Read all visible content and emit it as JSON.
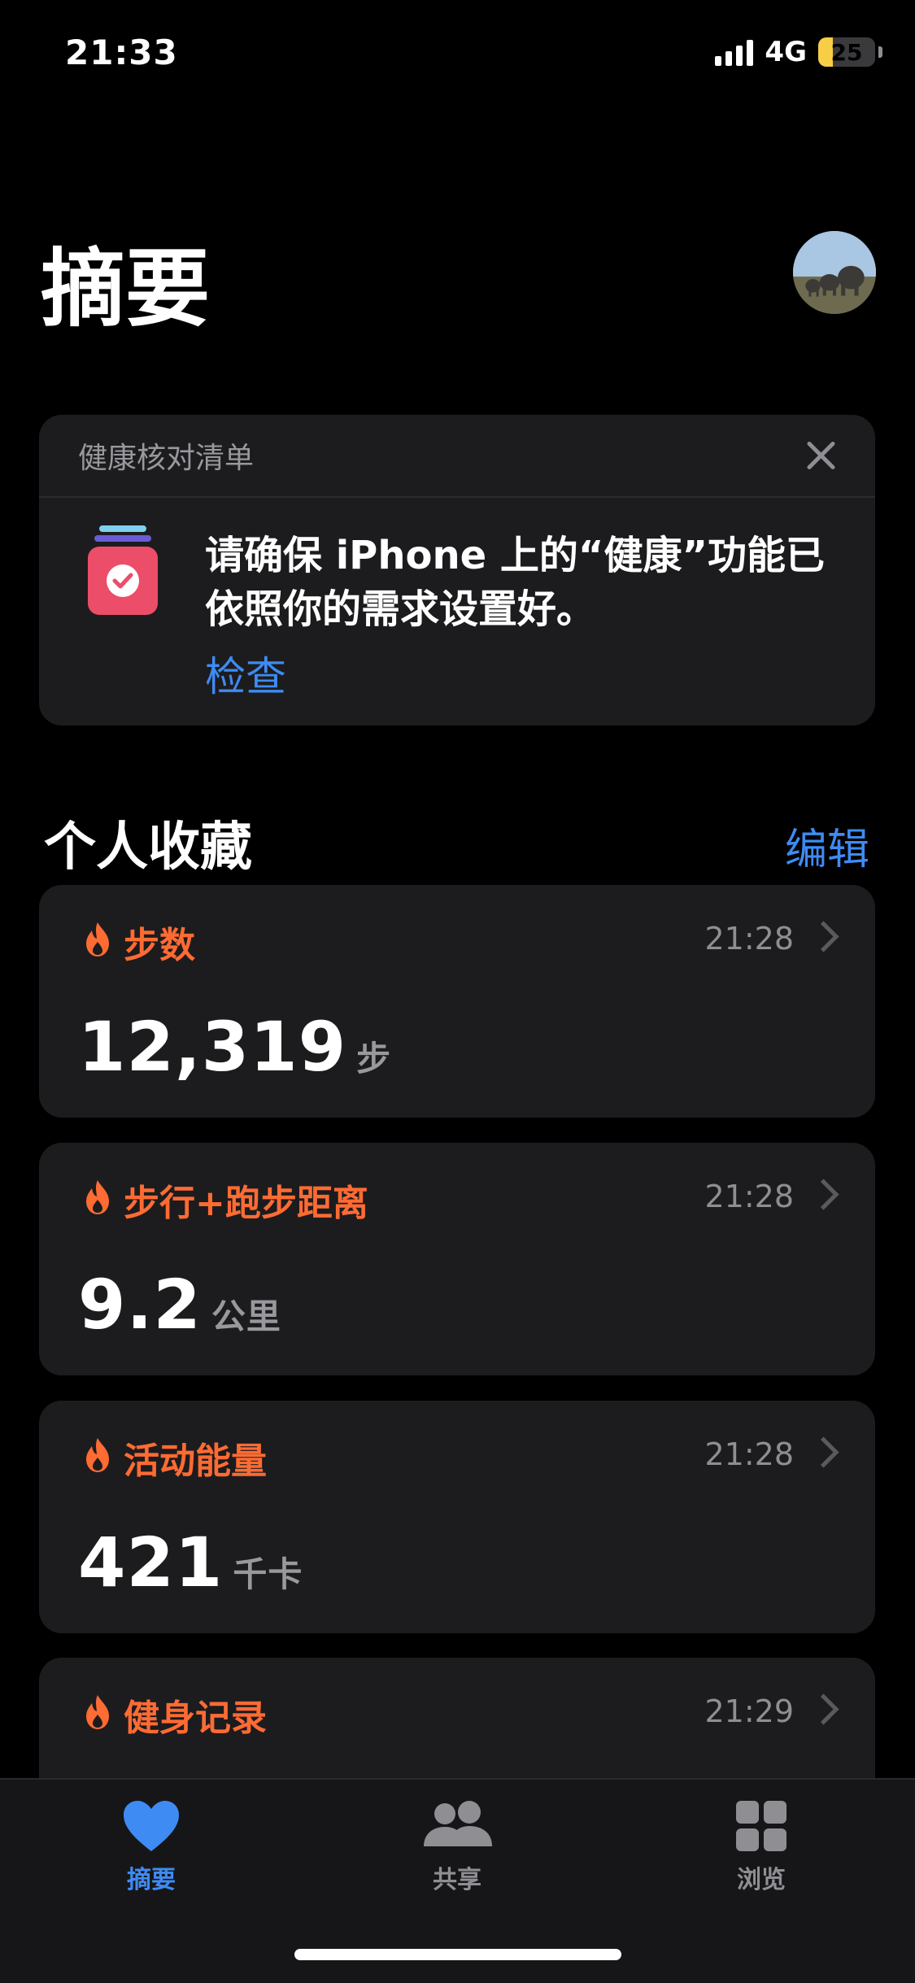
{
  "status_bar": {
    "time": "21:33",
    "network": "4G",
    "battery": "25",
    "battery_level": 0.25
  },
  "header": {
    "title": "摘要"
  },
  "checklist": {
    "title": "健康核对清单",
    "message": "请确保 iPhone 上的“健康”功能已依照你的需求设置好。",
    "link": "检查"
  },
  "favorites": {
    "title": "个人收藏",
    "edit_label": "编辑",
    "items": [
      {
        "title": "步数",
        "time": "21:28",
        "value": "12,319",
        "unit": "步"
      },
      {
        "title": "步行+跑步距离",
        "time": "21:28",
        "value": "9.2",
        "unit": "公里"
      },
      {
        "title": "活动能量",
        "time": "21:28",
        "value": "421",
        "unit": "千卡"
      },
      {
        "title": "健身记录",
        "time": "21:29"
      }
    ]
  },
  "tabbar": {
    "tabs": [
      {
        "label": "摘要",
        "icon": "heart-icon"
      },
      {
        "label": "共享",
        "icon": "people-icon"
      },
      {
        "label": "浏览",
        "icon": "grid-icon"
      }
    ]
  },
  "colors": {
    "accent": "#3e8bf3",
    "activity": "#fe6b33",
    "card": "#1c1c1e"
  }
}
